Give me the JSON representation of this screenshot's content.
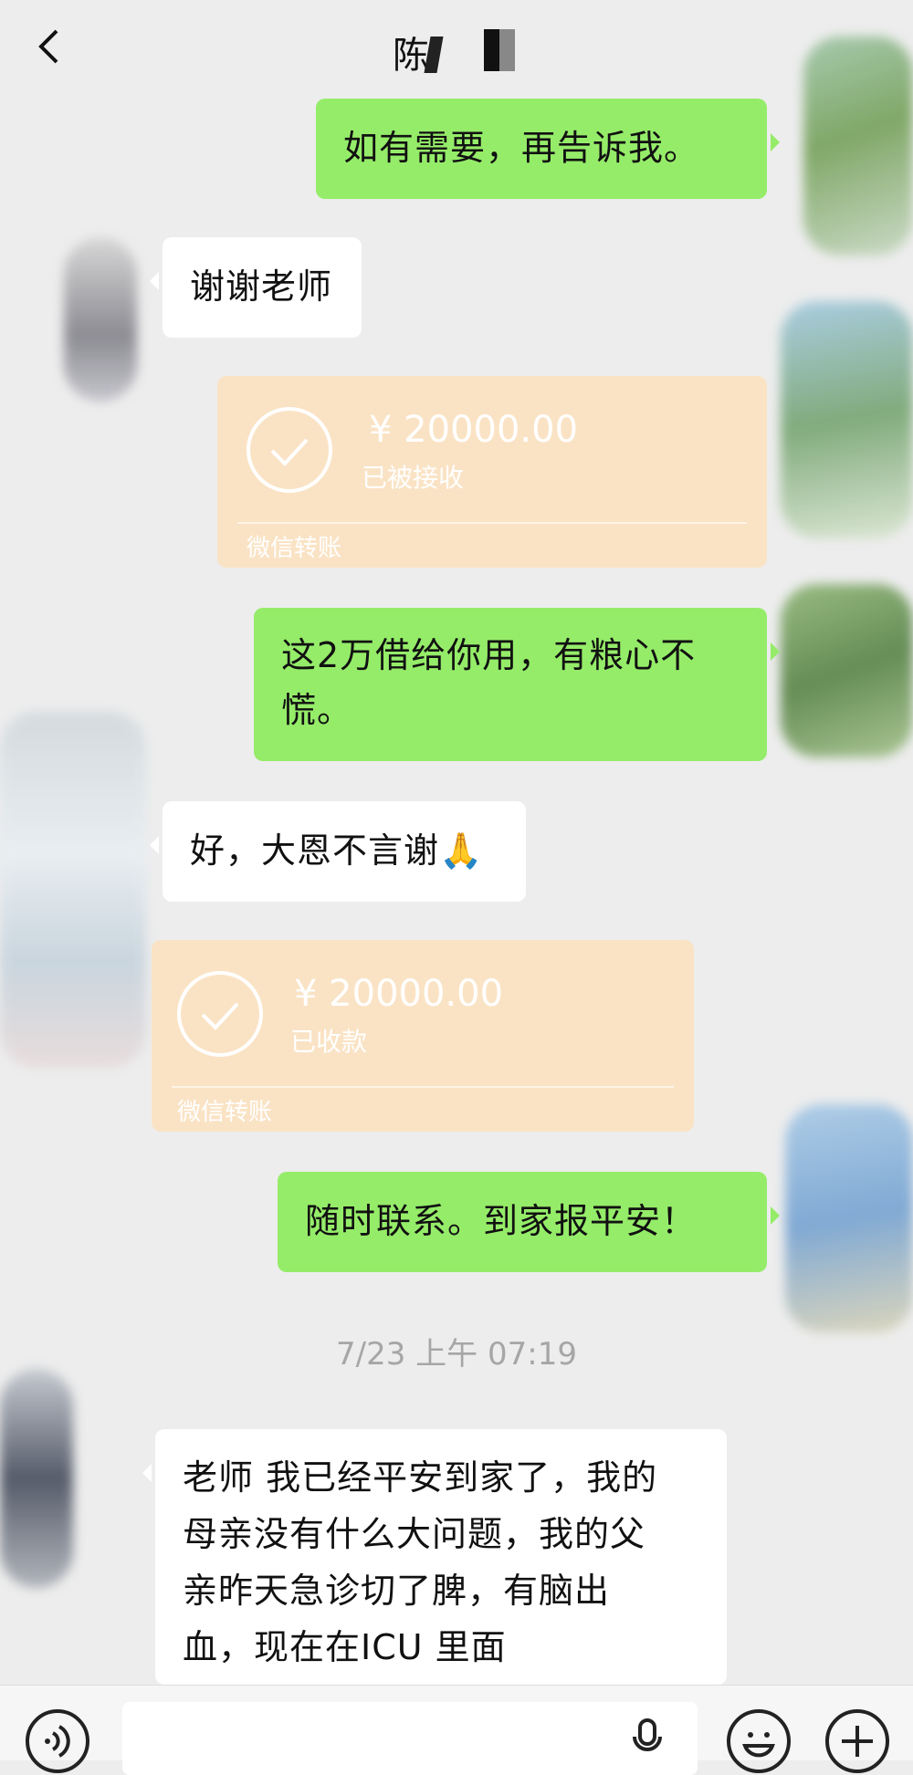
{
  "header": {
    "title": "陈"
  },
  "messages": [
    {
      "side": "out",
      "type": "text",
      "lines": [
        "如有需要，再告诉我。"
      ]
    },
    {
      "side": "in",
      "type": "text",
      "lines": [
        "谢谢老师"
      ]
    },
    {
      "side": "out",
      "type": "transfer",
      "amount": "¥ 20000.00",
      "status": "已被接收",
      "label": "微信转账"
    },
    {
      "side": "out",
      "type": "text",
      "lines": [
        "这2万借给你用，有粮心不",
        "慌。"
      ]
    },
    {
      "side": "in",
      "type": "text",
      "lines": [
        "好，大恩不言谢🙏"
      ]
    },
    {
      "side": "in",
      "type": "transfer",
      "amount": "¥ 20000.00",
      "status": "已收款",
      "label": "微信转账"
    },
    {
      "side": "out",
      "type": "text",
      "lines": [
        "随时联系。到家报平安！"
      ]
    },
    {
      "side": "in",
      "type": "text",
      "lines": [
        "老师 我已经平安到家了，我的",
        "母亲没有什么大问题，我的父",
        "亲昨天急诊切了脾，有脑出",
        "血，现在在ICU 里面"
      ]
    }
  ],
  "timestamp": "7/23 上午 07:19",
  "input_bar": {
    "icons": [
      "voice-icon",
      "microphone-icon",
      "emoji-icon",
      "plus-icon"
    ]
  },
  "colors": {
    "background": "#ededed",
    "outgoing_bubble": "#95ec69",
    "incoming_bubble": "#ffffff",
    "transfer_card": "#fae3c5",
    "timestamp_text": "#a6a6a6"
  }
}
